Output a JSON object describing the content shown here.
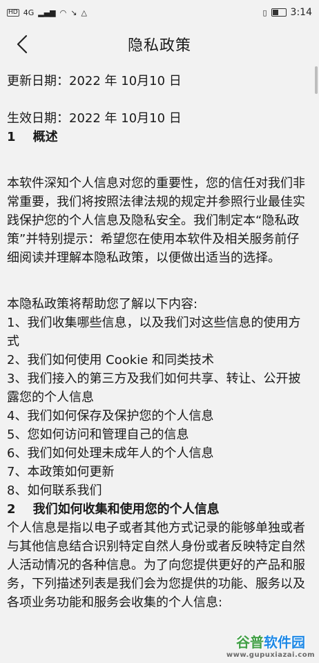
{
  "status_bar": {
    "hd": "HD",
    "network": "4G",
    "time": "3:14"
  },
  "nav": {
    "back_icon": "chevron-left-icon",
    "title": "隐私政策"
  },
  "content": {
    "update_date": "更新日期：2022 年 10月10 日",
    "effective_date": "生效日期：2022 年 10月10 日",
    "section1_heading": "1    概述",
    "intro_paragraph": "本软件深知个人信息对您的重要性，您的信任对我们非常重要，我们将按照法律法规的规定并参照行业最佳实践保护您的个人信息及隐私安全。我们制定本“隐私政策”并特别提示：希望您在使用本软件及相关服务前仔细阅读并理解本隐私政策，以便做出适当的选择。",
    "toc_intro": "本隐私政策将帮助您了解以下内容:",
    "toc": [
      "1、我们收集哪些信息，以及我们对这些信息的使用方式",
      "2、我们如何使用 Cookie 和同类技术",
      "3、我们接入的第三方及我们如何共享、转让、公开披露您的个人信息",
      "4、我们如何保存及保护您的个人信息",
      "5、您如何访问和管理自己的信息",
      "6、我们如何处理未成年人的个人信息",
      "7、本政策如何更新",
      "8、如何联系我们"
    ],
    "section2_heading": "2    我们如何收集和使用您的个人信息",
    "section2_paragraph": "个人信息是指以电子或者其他方式记录的能够单独或者与其他信息结合识别特定自然人身份或者反映特定自然人活动情况的各种信息。为了向您提供更好的产品和服务，下列描述列表是我们会为您提供的功能、服务以及各项业务功能和服务会收集的个人信息:"
  },
  "watermark": {
    "name_part1": "谷普",
    "name_part2": "软件园",
    "url": "www.gupuxiazai.com"
  }
}
